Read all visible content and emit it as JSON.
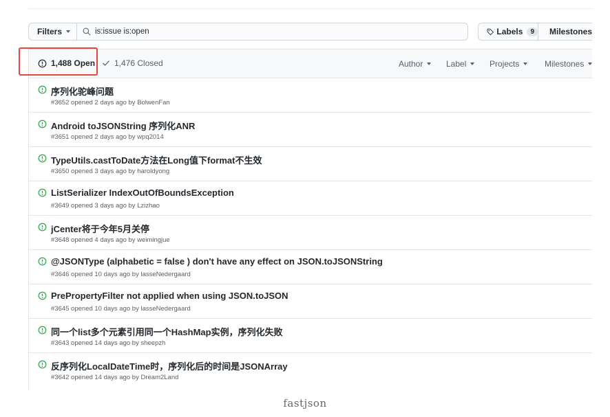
{
  "filter_bar": {
    "filters_label": "Filters",
    "search_value": "is:issue is:open",
    "labels_label": "Labels",
    "labels_count": "9",
    "milestones_label": "Milestones"
  },
  "header": {
    "open_label": "1,488 Open",
    "closed_label": "1,476 Closed",
    "author_label": "Author",
    "label_label": "Label",
    "projects_label": "Projects",
    "milestones_label": "Milestones"
  },
  "colors": {
    "open_icon": "#28a745",
    "highlight": "#e5453d"
  },
  "issues": [
    {
      "title": "序列化驼峰问题",
      "meta": "#3652 opened 2 days ago by BolwenFan"
    },
    {
      "title": "Android toJSONString 序列化ANR",
      "meta": "#3651 opened 2 days ago by wpq2014"
    },
    {
      "title": "TypeUtils.castToDate方法在Long值下format不生效",
      "meta": "#3650 opened 3 days ago by haroldyong"
    },
    {
      "title": "ListSerializer IndexOutOfBoundsException",
      "meta": "#3649 opened 3 days ago by Lzizhao"
    },
    {
      "title": "jCenter将于今年5月关停",
      "meta": "#3648 opened 4 days ago by weimingjue"
    },
    {
      "title": "@JSONType (alphabetic = false ) don't have any effect on JSON.toJSONString",
      "meta": "#3646 opened 10 days ago by lasseNedergaard"
    },
    {
      "title": "PrePropertyFilter not applied when using JSON.toJSON",
      "meta": "#3645 opened 10 days ago by lasseNedergaard"
    },
    {
      "title": "同一个list多个元素引用同一个HashMap实例，序列化失败",
      "meta": "#3643 opened 14 days ago by sheepzh"
    },
    {
      "title": "反序列化LocalDateTime时，序列化后的时间是JSONArray",
      "meta": "#3642 opened 14 days ago by Dream2Land"
    }
  ],
  "caption": "fastjson"
}
